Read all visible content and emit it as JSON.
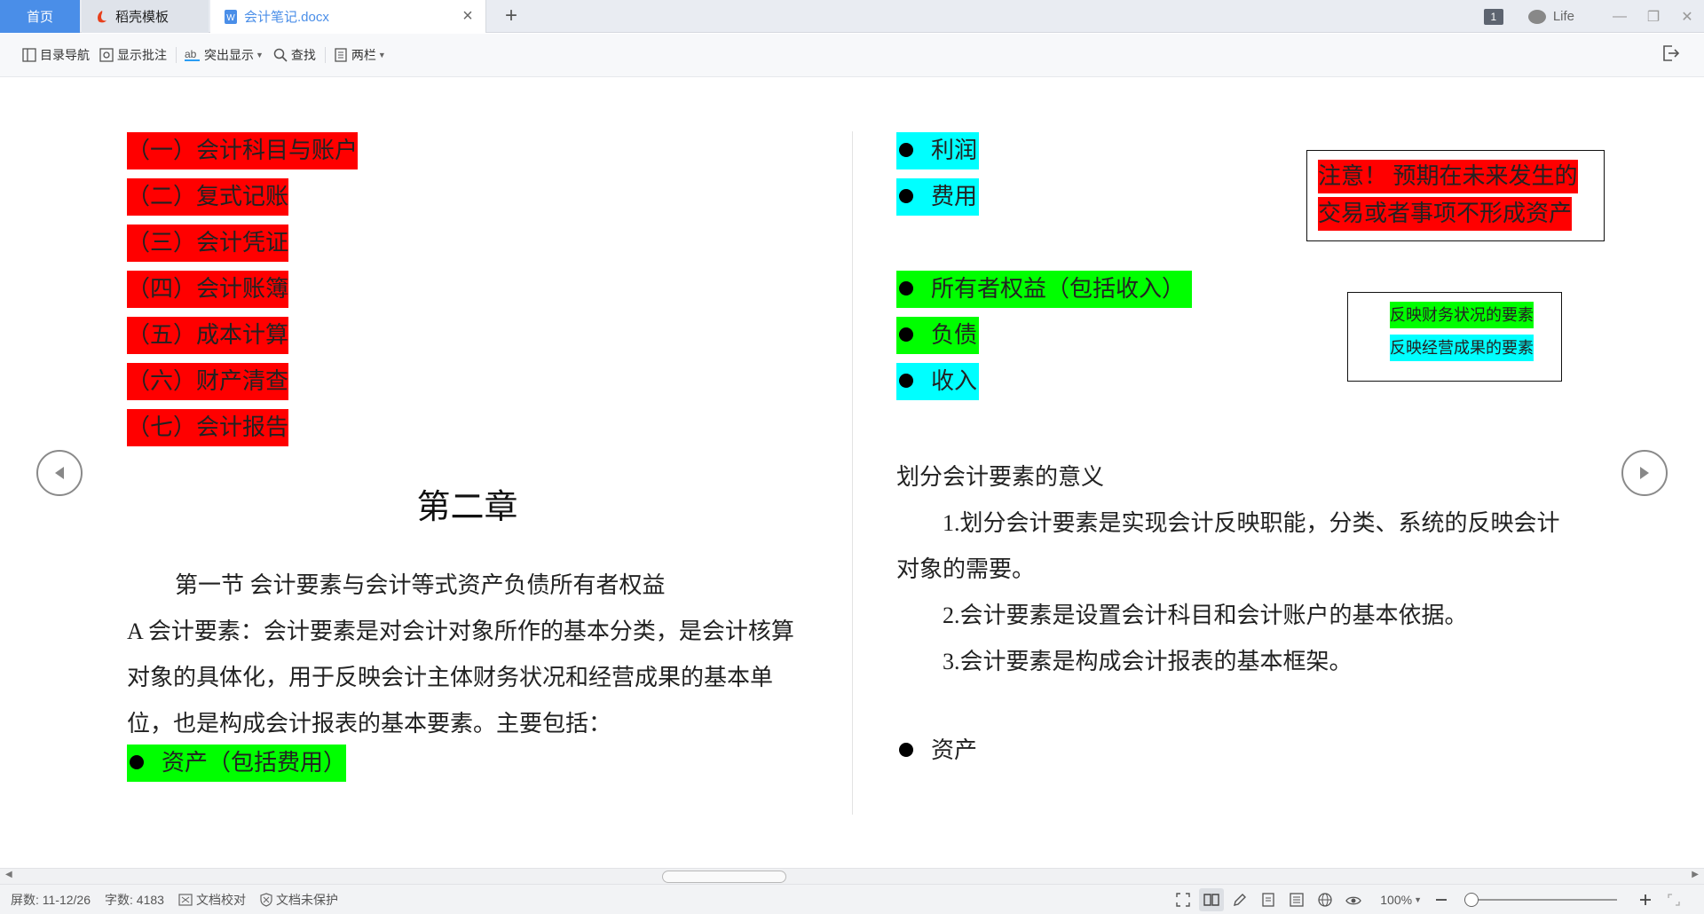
{
  "tabs": {
    "home": "首页",
    "template": "稻壳模板",
    "document": "会计笔记.docx"
  },
  "topbar": {
    "badge": "1",
    "user": "Life"
  },
  "toolbar": {
    "nav": "目录导航",
    "comments": "显示批注",
    "highlight": "突出显示",
    "find": "查找",
    "columns": "两栏"
  },
  "left_page": {
    "red_items": [
      "（一）会计科目与账户",
      "（二）复式记账",
      "（三）会计凭证",
      "（四）会计账簿",
      "（五）成本计算",
      "（六）财产清查",
      "（七）会计报告"
    ],
    "chapter": "第二章",
    "section": "第一节  会计要素与会计等式资产负债所有者权益",
    "body_lines": [
      "A 会计要素：会计要素是对会计对象所作的基本分类，是会计核算",
      "对象的具体化，用于反映会计主体财务状况和经营成果的基本单",
      "位，也是构成会计报表的基本要素。主要包括："
    ],
    "bullet_asset": "资产（包括费用）"
  },
  "right_page": {
    "bullets": {
      "profit": "利润",
      "expense": "费用",
      "equity": "所有者权益（包括收入）",
      "liability": "负债",
      "income": "收入",
      "asset": "资产"
    },
    "note_box": {
      "line1": "注意！  预期在未来发生的",
      "line2": "交易或者事项不形成资产"
    },
    "legend_box": {
      "green": "反映财务状况的要素",
      "cyan": "反映经营成果的要素"
    },
    "meaning_title": "划分会计要素的意义",
    "meaning_lines": [
      "1.划分会计要素是实现会计反映职能，分类、系统的反映会计",
      "对象的需要。",
      "2.会计要素是设置会计科目和会计账户的基本依据。",
      "3.会计要素是构成会计报表的基本框架。"
    ]
  },
  "statusbar": {
    "screen": "屏数: 11-12/26",
    "words": "字数: 4183",
    "proof": "文档校对",
    "protect": "文档未保护",
    "zoom": "100%"
  },
  "colors": {
    "tab_active": "#4a8ee8",
    "highlight_red": "#ff0000",
    "highlight_cyan": "#00ffff",
    "highlight_green": "#00ff00"
  }
}
